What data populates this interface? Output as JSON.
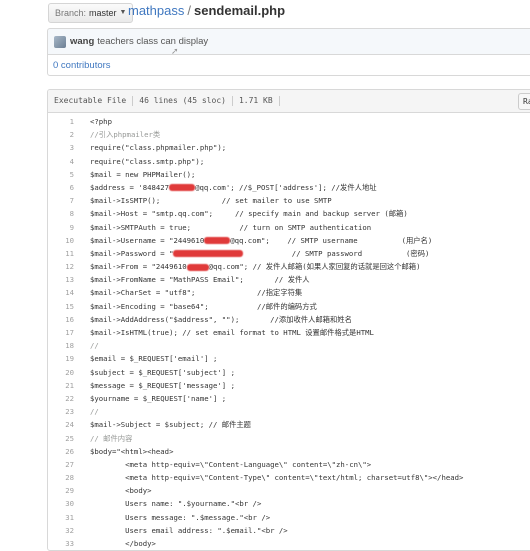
{
  "header": {
    "branch_prefix": "Branch:",
    "branch_name": "master",
    "repo": "mathpass",
    "separator": "/",
    "file": "sendemail.php"
  },
  "commit": {
    "author": "wang",
    "message": "teachers class can display"
  },
  "contributors": {
    "label": "0 contributors"
  },
  "file_info": {
    "mode": "Executable File",
    "lines": "46 lines (45 sloc)",
    "size": "1.71 KB",
    "raw_label": "Ra"
  },
  "code_lines": [
    {
      "n": "1",
      "t": "<?php"
    },
    {
      "n": "2",
      "t": "//引入phpmailer类"
    },
    {
      "n": "3",
      "t": "require(\"class.phpmailer.php\");"
    },
    {
      "n": "4",
      "t": "require(\"class.smtp.php\");"
    },
    {
      "n": "5",
      "t": "$mail = new PHPMailer();"
    },
    {
      "n": "6",
      "a": "$address = '848427",
      "b": "@qq.com'; //$_POST['address']; //发件人地址"
    },
    {
      "n": "7",
      "t": "$mail->IsSMTP();              // set mailer to use SMTP"
    },
    {
      "n": "8",
      "t": "$mail->Host = \"smtp.qq.com\";     // specify main and backup server (邮箱)"
    },
    {
      "n": "9",
      "t": "$mail->SMTPAuth = true;           // turn on SMTP authentication"
    },
    {
      "n": "10",
      "a": "$mail->Username = \"2449610",
      "b": "@qq.com\";    // SMTP username          (用户名)"
    },
    {
      "n": "11",
      "a": "$mail->Password = \"",
      "b": "           // SMTP password          (密码)"
    },
    {
      "n": "12",
      "a": "$mail->From = \"2449610",
      "b": "@qq.com\"; // 发件人邮箱(如果人家回复的话就是回这个邮箱)"
    },
    {
      "n": "13",
      "t": "$mail->FromName = \"MathPASS Email\";       // 发件人"
    },
    {
      "n": "14",
      "t": "$mail->CharSet = \"utf8\";              //指定字符集"
    },
    {
      "n": "15",
      "t": "$mail->Encoding = \"base64\";           //邮件的编码方式"
    },
    {
      "n": "16",
      "t": "$mail->AddAddress(\"$address\", \"\");       //添加收件人邮箱和姓名"
    },
    {
      "n": "17",
      "t": "$mail->IsHTML(true); // set email format to HTML 设置邮件格式是HTML"
    },
    {
      "n": "18",
      "t": "//"
    },
    {
      "n": "19",
      "t": "$email = $_REQUEST['email'] ;"
    },
    {
      "n": "20",
      "t": "$subject = $_REQUEST['subject'] ;"
    },
    {
      "n": "21",
      "t": "$message = $_REQUEST['message'] ;"
    },
    {
      "n": "22",
      "t": "$yourname = $_REQUEST['name'] ;"
    },
    {
      "n": "23",
      "t": "//"
    },
    {
      "n": "24",
      "t": "$mail->Subject = $subject; // 邮件主题"
    },
    {
      "n": "25",
      "t": "// 邮件内容"
    },
    {
      "n": "26",
      "t": "$body=\"<html><head>"
    },
    {
      "n": "27",
      "t": "        <meta http-equiv=\\\"Content-Language\\\" content=\\\"zh-cn\\\">"
    },
    {
      "n": "28",
      "t": "        <meta http-equiv=\\\"Content-Type\\\" content=\\\"text/html; charset=utf8\\\"></head>"
    },
    {
      "n": "29",
      "t": "        <body>"
    },
    {
      "n": "30",
      "t": "        Users name: \".$yourname.\"<br />"
    },
    {
      "n": "31",
      "t": "        Users message: \".$message.\"<br />"
    },
    {
      "n": "32",
      "t": "        Users email address: \".$email.\"<br />"
    },
    {
      "n": "33",
      "t": "        </body>"
    }
  ]
}
